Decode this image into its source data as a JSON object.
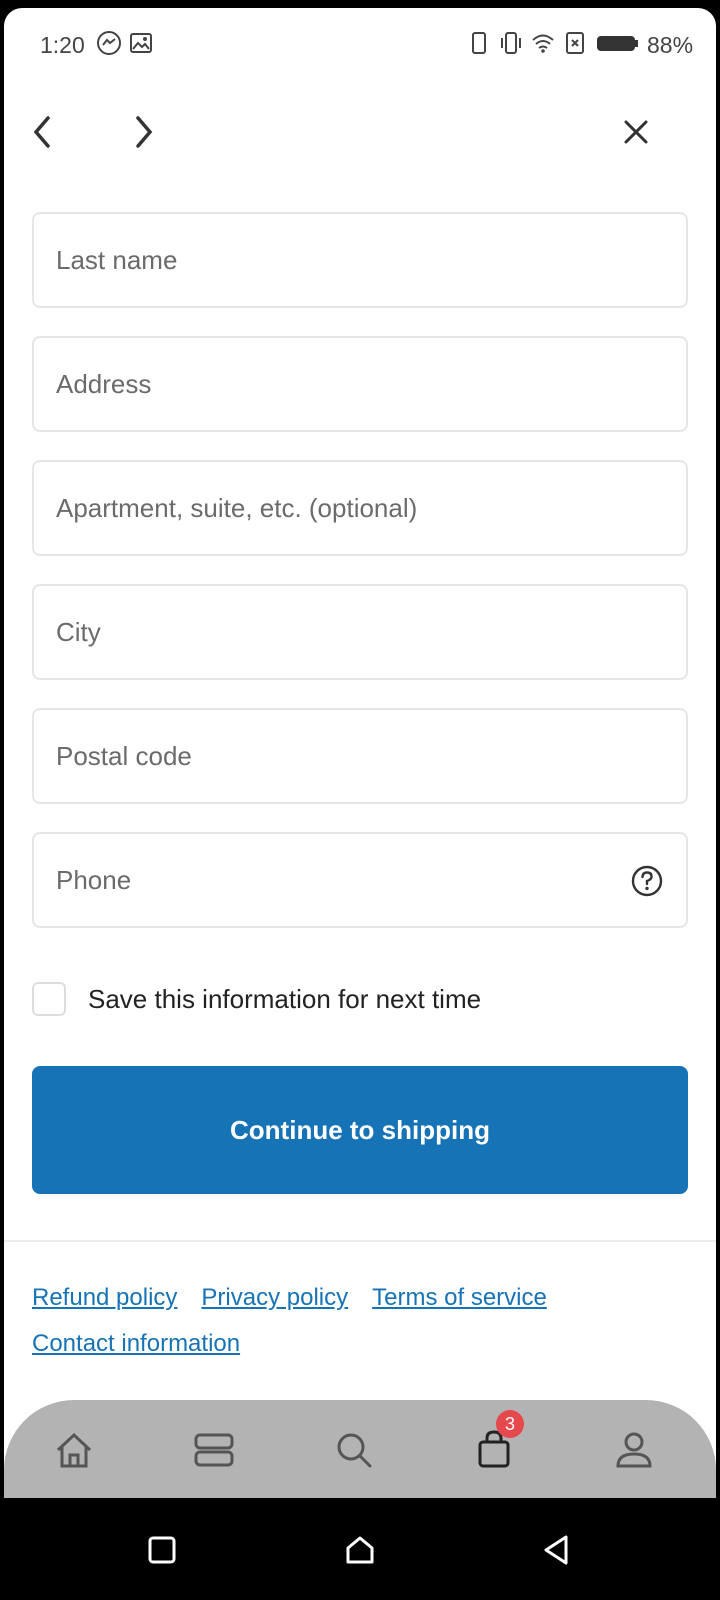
{
  "status_bar": {
    "time": "1:20",
    "battery": "88%",
    "left_icons": [
      "messenger-icon",
      "image-icon"
    ],
    "right_icons": [
      "phone-outline-icon",
      "vibrate-icon",
      "wifi-icon",
      "sim-x-icon",
      "battery-icon"
    ]
  },
  "nav": {
    "back_icon": "chevron-left-icon",
    "forward_icon": "chevron-right-icon",
    "close_icon": "close-icon"
  },
  "form": {
    "last_name_placeholder": "Last name",
    "address_placeholder": "Address",
    "apartment_placeholder": "Apartment, suite, etc. (optional)",
    "city_placeholder": "City",
    "postal_code_placeholder": "Postal code",
    "phone_placeholder": "Phone",
    "save_label": "Save this information for next time",
    "save_checked": false
  },
  "continue_button": "Continue to shipping",
  "footer_links": {
    "refund": "Refund policy",
    "privacy": "Privacy policy",
    "terms": "Terms of service",
    "contact": "Contact information"
  },
  "tabbar": {
    "items": [
      "home-icon",
      "collections-icon",
      "search-icon",
      "cart-icon",
      "account-icon"
    ],
    "cart_count": "3"
  },
  "colors": {
    "primary": "#1673b6",
    "badge": "#e5484d",
    "tabbar_bg": "#b3b3b3"
  }
}
